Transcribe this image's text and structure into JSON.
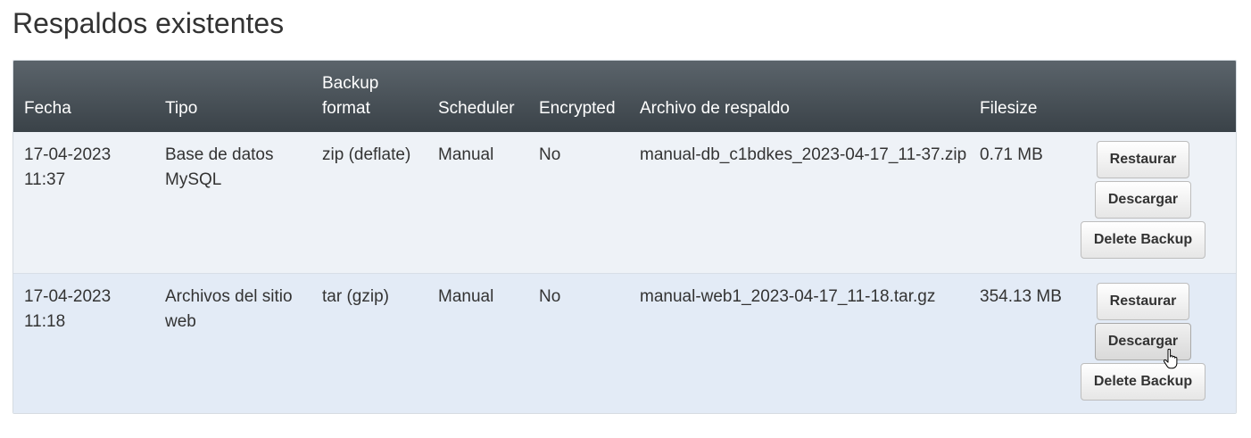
{
  "page": {
    "title": "Respaldos existentes"
  },
  "table": {
    "columns": [
      "Fecha",
      "Tipo",
      "Backup format",
      "Scheduler",
      "Encrypted",
      "Archivo de respaldo",
      "Filesize"
    ],
    "rows": [
      {
        "fecha": "17-04-2023 11:37",
        "tipo": "Base de datos MySQL",
        "format": "zip (deflate)",
        "scheduler": "Manual",
        "encrypted": "No",
        "archivo": "manual-db_c1bdkes_2023-04-17_11-37.zip",
        "filesize": "0.71 MB",
        "restore_label": "Restaurar",
        "download_label": "Descargar",
        "delete_label": "Delete Backup"
      },
      {
        "fecha": "17-04-2023 11:18",
        "tipo": "Archivos del sitio web",
        "format": "tar (gzip)",
        "scheduler": "Manual",
        "encrypted": "No",
        "archivo": "manual-web1_2023-04-17_11-18.tar.gz",
        "filesize": "354.13 MB",
        "restore_label": "Restaurar",
        "download_label": "Descargar",
        "delete_label": "Delete Backup"
      }
    ]
  },
  "colors": {
    "header_top": "#5b646b",
    "header_bottom": "#3a4248",
    "row_odd": "#eef2f7",
    "row_even": "#e3ebf6"
  },
  "cursor": {
    "icon": "hand-pointer-icon",
    "hovered": "rows.1.download"
  }
}
